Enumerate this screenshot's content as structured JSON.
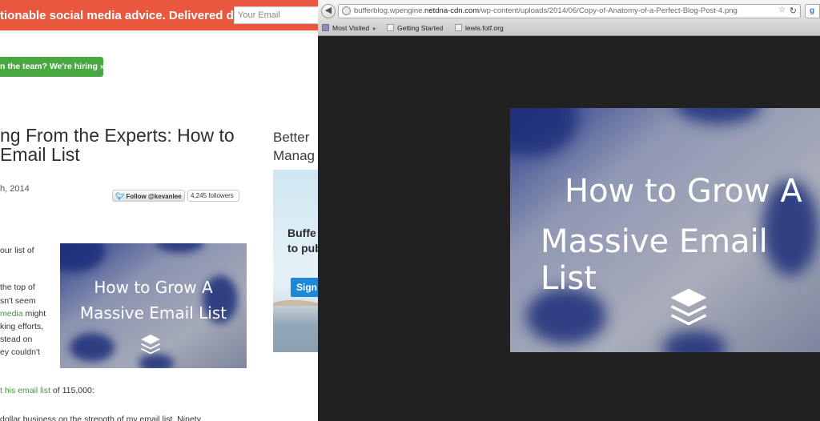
{
  "blog": {
    "banner": {
      "tagline": "tionable social media advice. Delivered daily.",
      "email_placeholder": "Your Email"
    },
    "hiring_button": "n the team? We're hiring »",
    "article": {
      "title_lines": [
        "ng From the Experts: How to",
        "Email List"
      ],
      "date": "h, 2014",
      "follow_label": "Follow @kevanlee",
      "followers_count": "4,245 followers",
      "body_lines": [
        {
          "before": "our list of",
          "link": "",
          "after": ""
        },
        {
          "before": "the top of",
          "link": "",
          "after": ""
        },
        {
          "before": "sn't seem",
          "link": "",
          "after": ""
        },
        {
          "before": "",
          "link": "media",
          "after": " might"
        },
        {
          "before": "king efforts,",
          "link": "",
          "after": ""
        },
        {
          "before": "stead on",
          "link": "",
          "after": ""
        },
        {
          "before": "ey couldn't",
          "link": "",
          "after": ""
        }
      ],
      "email_list_line": {
        "link": "t his email list",
        "after": " of 115,000:"
      },
      "bottom_line": "dollar business on the strength of my email list. Ninety"
    },
    "image": {
      "line1": "How to Grow A",
      "line2": "Massive Email List",
      "icon": "buffer-stack-icon"
    },
    "sidebar": {
      "title_lines": [
        "Better",
        "Manag"
      ],
      "ad_lines": [
        "Buffe",
        "to pub"
      ],
      "ad_button": "Sign"
    }
  },
  "browser": {
    "url": {
      "prefix": "bufferblog.wpengine.",
      "host": "netdna-cdn.com",
      "path": "/wp-content/uploads/2014/06/Copy-of-Anatomy-of-a-Perfect-Blog-Post-4.png"
    },
    "search_engine_icon": "g",
    "bookmarks": [
      {
        "label": "Most Visited",
        "icon": "folder-icon",
        "has_caret": true
      },
      {
        "label": "Getting Started",
        "icon": "page-icon",
        "has_caret": false
      },
      {
        "label": "lewis.fotf.org",
        "icon": "page-icon",
        "has_caret": false
      }
    ],
    "image": {
      "line1": "How to Grow A",
      "line2": "Massive Email List",
      "icon": "buffer-stack-icon"
    }
  },
  "colors": {
    "banner": "#e8573e",
    "hiring_green": "#4aa843",
    "link_green": "#3d9b34",
    "viewer_background": "#212121"
  }
}
